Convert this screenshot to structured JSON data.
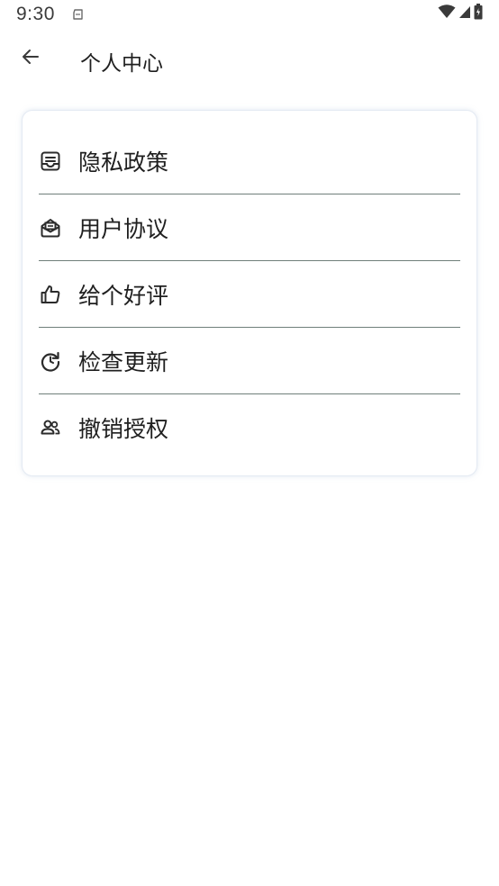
{
  "status_bar": {
    "time": "9:30",
    "icons": [
      "notification-icon",
      "wifi-icon",
      "signal-icon",
      "battery-icon"
    ]
  },
  "header": {
    "back_icon": "arrow-left-icon",
    "title": "个人中心"
  },
  "menu": {
    "items": [
      {
        "label": "隐私政策",
        "icon": "privacy-inbox-icon"
      },
      {
        "label": "用户协议",
        "icon": "mail-open-icon"
      },
      {
        "label": "给个好评",
        "icon": "thumbs-up-icon"
      },
      {
        "label": "检查更新",
        "icon": "refresh-icon"
      },
      {
        "label": "撤销授权",
        "icon": "users-icon"
      }
    ]
  },
  "colors": {
    "divider": "#6f7f7a",
    "card_border": "#e4eaf3",
    "text": "#1f1f1f",
    "icon": "#2b2b2b"
  }
}
